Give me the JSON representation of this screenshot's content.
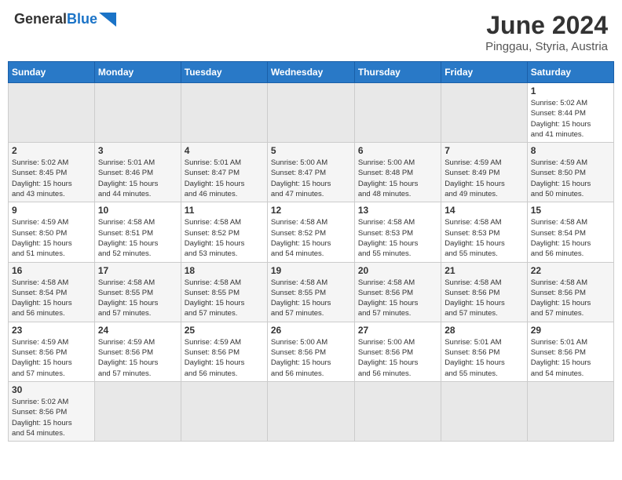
{
  "header": {
    "logo_general": "General",
    "logo_blue": "Blue",
    "month_title": "June 2024",
    "location": "Pinggau, Styria, Austria"
  },
  "weekdays": [
    "Sunday",
    "Monday",
    "Tuesday",
    "Wednesday",
    "Thursday",
    "Friday",
    "Saturday"
  ],
  "weeks": [
    [
      {
        "day": "",
        "info": ""
      },
      {
        "day": "",
        "info": ""
      },
      {
        "day": "",
        "info": ""
      },
      {
        "day": "",
        "info": ""
      },
      {
        "day": "",
        "info": ""
      },
      {
        "day": "",
        "info": ""
      },
      {
        "day": "1",
        "info": "Sunrise: 5:02 AM\nSunset: 8:44 PM\nDaylight: 15 hours\nand 41 minutes."
      }
    ],
    [
      {
        "day": "2",
        "info": "Sunrise: 5:02 AM\nSunset: 8:45 PM\nDaylight: 15 hours\nand 43 minutes."
      },
      {
        "day": "3",
        "info": "Sunrise: 5:01 AM\nSunset: 8:46 PM\nDaylight: 15 hours\nand 44 minutes."
      },
      {
        "day": "4",
        "info": "Sunrise: 5:01 AM\nSunset: 8:47 PM\nDaylight: 15 hours\nand 46 minutes."
      },
      {
        "day": "5",
        "info": "Sunrise: 5:00 AM\nSunset: 8:47 PM\nDaylight: 15 hours\nand 47 minutes."
      },
      {
        "day": "6",
        "info": "Sunrise: 5:00 AM\nSunset: 8:48 PM\nDaylight: 15 hours\nand 48 minutes."
      },
      {
        "day": "7",
        "info": "Sunrise: 4:59 AM\nSunset: 8:49 PM\nDaylight: 15 hours\nand 49 minutes."
      },
      {
        "day": "8",
        "info": "Sunrise: 4:59 AM\nSunset: 8:50 PM\nDaylight: 15 hours\nand 50 minutes."
      }
    ],
    [
      {
        "day": "9",
        "info": "Sunrise: 4:59 AM\nSunset: 8:50 PM\nDaylight: 15 hours\nand 51 minutes."
      },
      {
        "day": "10",
        "info": "Sunrise: 4:58 AM\nSunset: 8:51 PM\nDaylight: 15 hours\nand 52 minutes."
      },
      {
        "day": "11",
        "info": "Sunrise: 4:58 AM\nSunset: 8:52 PM\nDaylight: 15 hours\nand 53 minutes."
      },
      {
        "day": "12",
        "info": "Sunrise: 4:58 AM\nSunset: 8:52 PM\nDaylight: 15 hours\nand 54 minutes."
      },
      {
        "day": "13",
        "info": "Sunrise: 4:58 AM\nSunset: 8:53 PM\nDaylight: 15 hours\nand 55 minutes."
      },
      {
        "day": "14",
        "info": "Sunrise: 4:58 AM\nSunset: 8:53 PM\nDaylight: 15 hours\nand 55 minutes."
      },
      {
        "day": "15",
        "info": "Sunrise: 4:58 AM\nSunset: 8:54 PM\nDaylight: 15 hours\nand 56 minutes."
      }
    ],
    [
      {
        "day": "16",
        "info": "Sunrise: 4:58 AM\nSunset: 8:54 PM\nDaylight: 15 hours\nand 56 minutes."
      },
      {
        "day": "17",
        "info": "Sunrise: 4:58 AM\nSunset: 8:55 PM\nDaylight: 15 hours\nand 57 minutes."
      },
      {
        "day": "18",
        "info": "Sunrise: 4:58 AM\nSunset: 8:55 PM\nDaylight: 15 hours\nand 57 minutes."
      },
      {
        "day": "19",
        "info": "Sunrise: 4:58 AM\nSunset: 8:55 PM\nDaylight: 15 hours\nand 57 minutes."
      },
      {
        "day": "20",
        "info": "Sunrise: 4:58 AM\nSunset: 8:56 PM\nDaylight: 15 hours\nand 57 minutes."
      },
      {
        "day": "21",
        "info": "Sunrise: 4:58 AM\nSunset: 8:56 PM\nDaylight: 15 hours\nand 57 minutes."
      },
      {
        "day": "22",
        "info": "Sunrise: 4:58 AM\nSunset: 8:56 PM\nDaylight: 15 hours\nand 57 minutes."
      }
    ],
    [
      {
        "day": "23",
        "info": "Sunrise: 4:59 AM\nSunset: 8:56 PM\nDaylight: 15 hours\nand 57 minutes."
      },
      {
        "day": "24",
        "info": "Sunrise: 4:59 AM\nSunset: 8:56 PM\nDaylight: 15 hours\nand 57 minutes."
      },
      {
        "day": "25",
        "info": "Sunrise: 4:59 AM\nSunset: 8:56 PM\nDaylight: 15 hours\nand 56 minutes."
      },
      {
        "day": "26",
        "info": "Sunrise: 5:00 AM\nSunset: 8:56 PM\nDaylight: 15 hours\nand 56 minutes."
      },
      {
        "day": "27",
        "info": "Sunrise: 5:00 AM\nSunset: 8:56 PM\nDaylight: 15 hours\nand 56 minutes."
      },
      {
        "day": "28",
        "info": "Sunrise: 5:01 AM\nSunset: 8:56 PM\nDaylight: 15 hours\nand 55 minutes."
      },
      {
        "day": "29",
        "info": "Sunrise: 5:01 AM\nSunset: 8:56 PM\nDaylight: 15 hours\nand 54 minutes."
      }
    ],
    [
      {
        "day": "30",
        "info": "Sunrise: 5:02 AM\nSunset: 8:56 PM\nDaylight: 15 hours\nand 54 minutes."
      },
      {
        "day": "",
        "info": ""
      },
      {
        "day": "",
        "info": ""
      },
      {
        "day": "",
        "info": ""
      },
      {
        "day": "",
        "info": ""
      },
      {
        "day": "",
        "info": ""
      },
      {
        "day": "",
        "info": ""
      }
    ]
  ]
}
